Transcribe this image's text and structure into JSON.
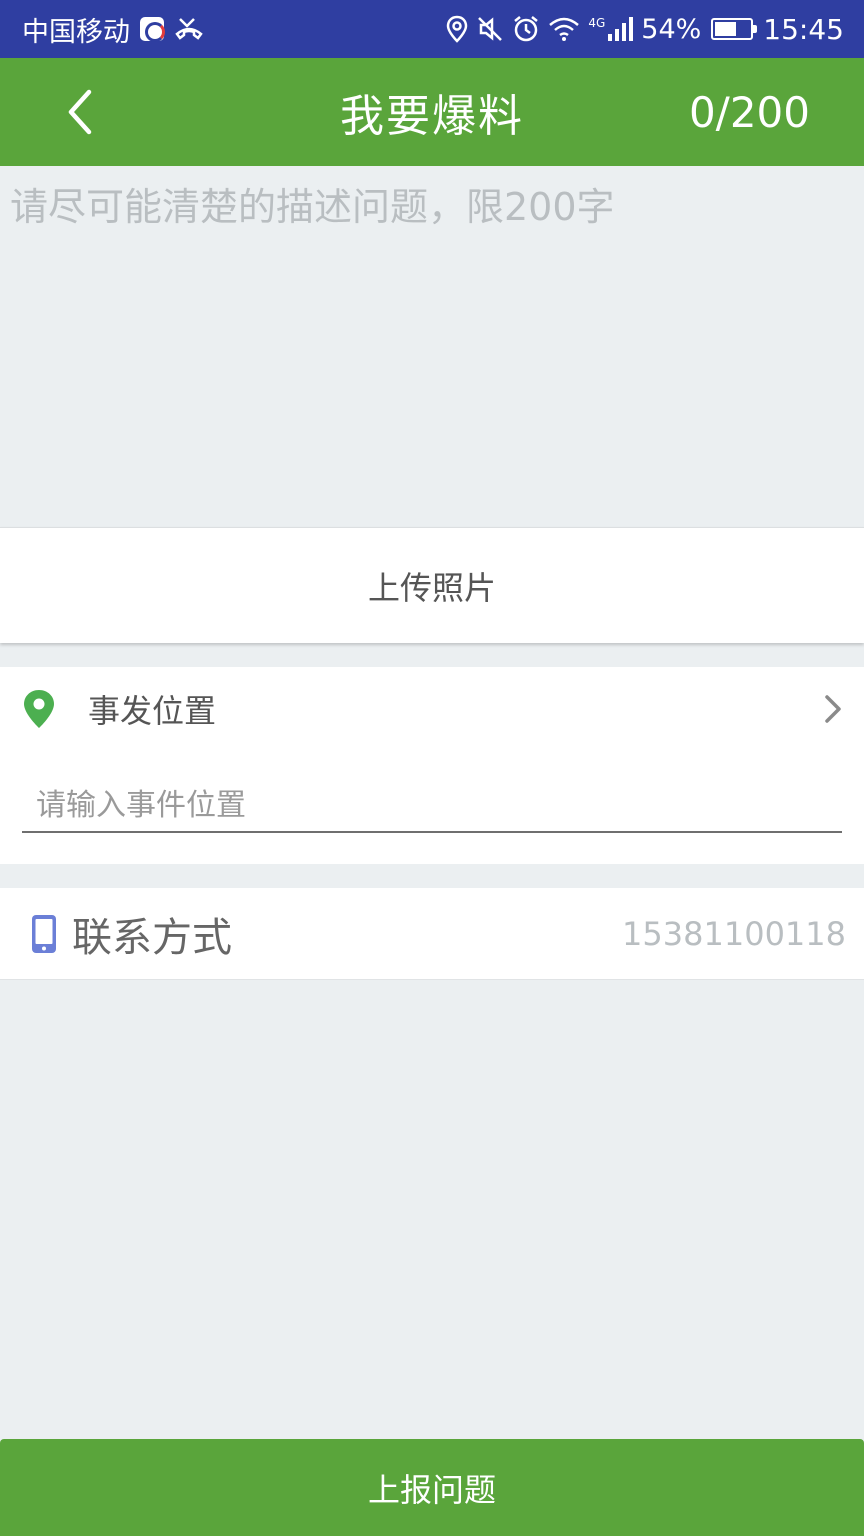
{
  "status_bar": {
    "carrier": "中国移动",
    "battery_percent": "54%",
    "network": "4G",
    "time": "15:45",
    "battery_level": 0.54,
    "icons": [
      "carrier-badge-icon",
      "missed-call-icon",
      "location-icon",
      "mute-icon",
      "alarm-icon",
      "wifi-icon",
      "signal-icon",
      "battery-icon"
    ]
  },
  "app_bar": {
    "title": "我要爆料",
    "counter": "0/200",
    "back_icon": "chevron-left-icon"
  },
  "description": {
    "placeholder": "请尽可能清楚的描述问题，限200字",
    "value": ""
  },
  "upload": {
    "label": "上传照片"
  },
  "location": {
    "label": "事发位置",
    "input_placeholder": "请输入事件位置",
    "input_value": "",
    "icon": "map-pin-icon",
    "chevron": "chevron-right-icon"
  },
  "contact": {
    "label": "联系方式",
    "value": "15381100118",
    "icon": "phone-icon"
  },
  "submit": {
    "label": "上报问题"
  },
  "colors": {
    "status_bar": "#2f3ea1",
    "brand_green": "#5aa53b",
    "pin_green": "#4caf50",
    "phone_blue": "#6b7fd7",
    "background": "#ebeff1"
  }
}
